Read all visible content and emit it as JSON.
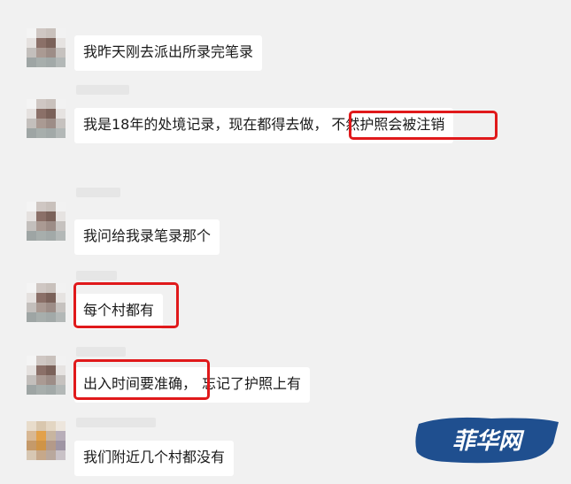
{
  "messages": [
    {
      "text": "我昨天刚去派出所录完笔录"
    },
    {
      "text_a": "我是18年的处境记录，现在都得去做，",
      "text_b": "不然护照会被注销"
    },
    {
      "text": "我问给我录笔录那个"
    },
    {
      "text": "每个村都有"
    },
    {
      "text_a": "出入时间要准确，",
      "text_b": "忘记了护照上有"
    },
    {
      "text": "我们附近几个村都没有"
    }
  ],
  "watermark": {
    "text": "菲华网"
  },
  "colors": {
    "background": "#f1f1f1",
    "bubble": "#ffffff",
    "highlight": "#e0191b",
    "watermark": "#1f4f8f"
  }
}
